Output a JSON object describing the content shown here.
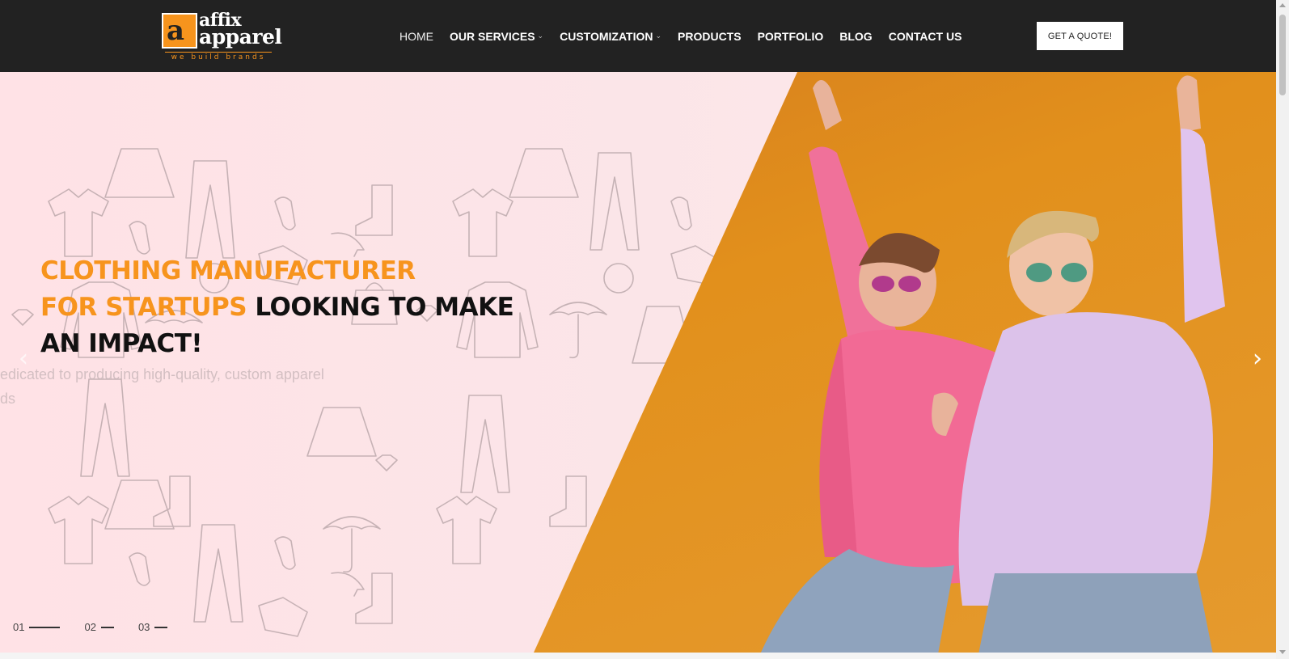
{
  "brand": {
    "name_line1": "affix",
    "name_line2": "apparel",
    "tagline": "we build brands",
    "mark_letter": "a",
    "accent_color": "#f7941d",
    "header_color": "#222222"
  },
  "nav": {
    "items": [
      {
        "label": "HOME",
        "has_dropdown": false
      },
      {
        "label": "OUR SERVICES",
        "has_dropdown": true
      },
      {
        "label": "CUSTOMIZATION",
        "has_dropdown": true
      },
      {
        "label": "PRODUCTS",
        "has_dropdown": false
      },
      {
        "label": "PORTFOLIO",
        "has_dropdown": false
      },
      {
        "label": "BLOG",
        "has_dropdown": false
      },
      {
        "label": "CONTACT US",
        "has_dropdown": false
      }
    ],
    "dropdown_icon": "chevron-down-icon",
    "chev_glyph": "⌄"
  },
  "cta": {
    "label": "GET A QUOTE!"
  },
  "hero": {
    "headline_orange_1": "CLOTHING MANUFACTURER",
    "headline_orange_2": "FOR STARTUPS",
    "headline_dark_1": " LOOKING TO MAKE",
    "headline_dark_2": "AN IMPACT!",
    "sub_line1": "edicated to producing high-quality, custom apparel",
    "sub_line2": "ds",
    "prev_icon": "chevron-left-icon",
    "next_icon": "chevron-right-icon",
    "prev_glyph": "‹",
    "next_glyph": "›",
    "slides": [
      {
        "num": "01",
        "active": true
      },
      {
        "num": "02",
        "active": false
      },
      {
        "num": "03",
        "active": false
      }
    ]
  }
}
